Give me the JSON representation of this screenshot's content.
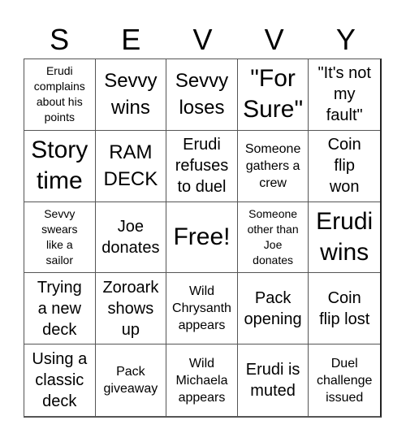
{
  "title_letters": [
    "S",
    "E",
    "V",
    "V",
    "Y"
  ],
  "cells": [
    {
      "text": "Erudi\ncomplains\nabout his\npoints",
      "size": "xs"
    },
    {
      "text": "Sevvy\nwins",
      "size": "lg"
    },
    {
      "text": "Sevvy\nloses",
      "size": "lg"
    },
    {
      "text": "\"For\nSure\"",
      "size": "xl"
    },
    {
      "text": "\"It's not\nmy\nfault\"",
      "size": "md"
    },
    {
      "text": "Story\ntime",
      "size": "xl"
    },
    {
      "text": "RAM\nDECK",
      "size": "lg"
    },
    {
      "text": "Erudi\nrefuses\nto duel",
      "size": "md"
    },
    {
      "text": "Someone\ngathers a\ncrew",
      "size": "sm"
    },
    {
      "text": "Coin\nflip\nwon",
      "size": "md"
    },
    {
      "text": "Sevvy\nswears\nlike a\nsailor",
      "size": "xs"
    },
    {
      "text": "Joe\ndonates",
      "size": "md"
    },
    {
      "text": "Free!",
      "size": "xl"
    },
    {
      "text": "Someone\nother than\nJoe\ndonates",
      "size": "xs"
    },
    {
      "text": "Erudi\nwins",
      "size": "xl"
    },
    {
      "text": "Trying\na new\ndeck",
      "size": "md"
    },
    {
      "text": "Zoroark\nshows\nup",
      "size": "md"
    },
    {
      "text": "Wild\nChrysanth\nappears",
      "size": "sm"
    },
    {
      "text": "Pack\nopening",
      "size": "md"
    },
    {
      "text": "Coin\nflip lost",
      "size": "md"
    },
    {
      "text": "Using a\nclassic\ndeck",
      "size": "md"
    },
    {
      "text": "Pack\ngiveaway",
      "size": "sm"
    },
    {
      "text": "Wild\nMichaela\nappears",
      "size": "sm"
    },
    {
      "text": "Erudi is\nmuted",
      "size": "md"
    },
    {
      "text": "Duel\nchallenge\nissued",
      "size": "sm"
    }
  ]
}
